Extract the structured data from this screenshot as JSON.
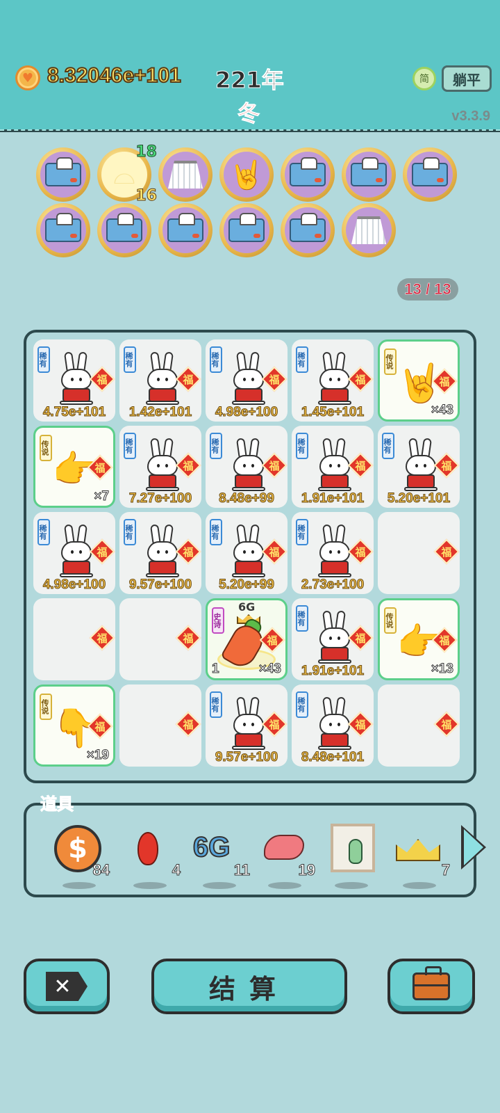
{
  "header": {
    "coins": "8.32046e+101",
    "year": "221年",
    "season": "冬",
    "simplified_label": "简",
    "tangping_label": "躺平",
    "version": "v3.3.9"
  },
  "relics": {
    "row1": [
      "tissue-box-icon",
      "shell-icon",
      "skirt-icon",
      "rock-hand-icon",
      "tissue-box-icon",
      "tissue-box-icon",
      "tissue-box-icon"
    ],
    "row2": [
      "tissue-box-icon",
      "tissue-box-icon",
      "tissue-box-icon",
      "tissue-box-icon",
      "tissue-box-icon",
      "skirt-icon"
    ],
    "shell_top": "18",
    "shell_bottom": "16"
  },
  "progress": "13 / 13",
  "rarity": {
    "rare": "稀有",
    "legend": "传说",
    "epic": "史诗",
    "fu": "福"
  },
  "board": {
    "r0": [
      "4.75e+101",
      "1.42e+101",
      "4.98e+100",
      "1.45e+101",
      "×43"
    ],
    "r1": [
      "×7",
      "7.27e+100",
      "8.48e+99",
      "1.91e+101",
      "5.20e+101"
    ],
    "r2": [
      "4.98e+100",
      "9.57e+100",
      "5.20e+99",
      "2.73e+100",
      ""
    ],
    "r3": [
      "",
      "",
      "×43",
      "1.91e+101",
      "×13"
    ],
    "r4": [
      "×19",
      "",
      "9.57e+100",
      "8.48e+101",
      ""
    ],
    "carrot_level": "1",
    "carrot_tag": "6G"
  },
  "props": {
    "label": "道具",
    "items": [
      {
        "icon": "dollar-coin-icon",
        "count": "84"
      },
      {
        "icon": "red-pepper-icon",
        "count": "4"
      },
      {
        "icon": "6g-icon",
        "count": "11",
        "text": "6G"
      },
      {
        "icon": "liver-icon",
        "count": "19"
      },
      {
        "icon": "vase-frame-icon",
        "count": ""
      },
      {
        "icon": "crown-icon",
        "count": "7"
      }
    ]
  },
  "buttons": {
    "close": "✕",
    "settle": "结算",
    "bag": "briefcase-icon"
  }
}
